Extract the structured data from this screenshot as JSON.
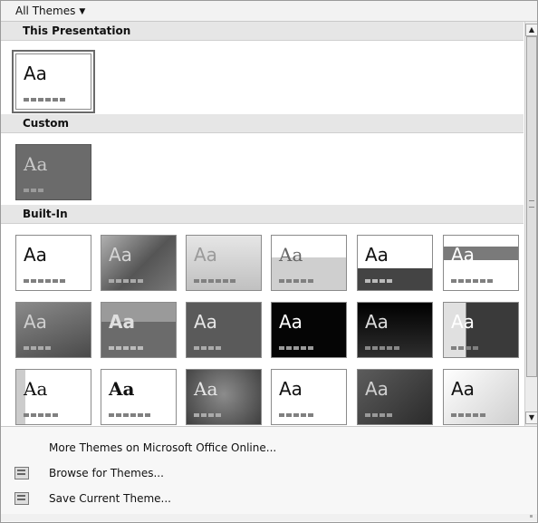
{
  "filter": {
    "label": "All Themes",
    "caret": "▼"
  },
  "sections": [
    {
      "title": "This Presentation"
    },
    {
      "title": "Custom"
    },
    {
      "title": "Built-In"
    }
  ],
  "thumb_text": "Aa",
  "scrollbar": {
    "up": "▲",
    "down": "▼"
  },
  "menu": [
    {
      "label": "More Themes on Microsoft Office Online...",
      "icon": "none"
    },
    {
      "label": "Browse for Themes...",
      "icon": "folder-icon"
    },
    {
      "label": "Save Current Theme...",
      "icon": "save-theme-icon"
    }
  ]
}
